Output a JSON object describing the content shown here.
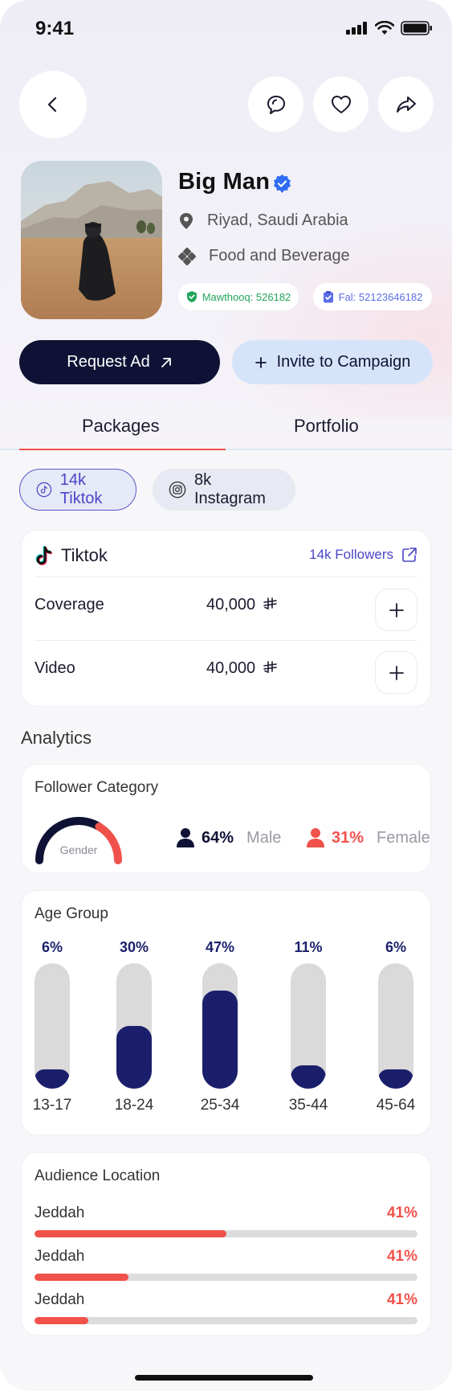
{
  "status_bar": {
    "time": "9:41"
  },
  "profile": {
    "name": "Big Man",
    "location": "Riyad, Saudi Arabia",
    "category": "Food and Beverage",
    "badges": [
      {
        "label": "Mawthooq: 526182",
        "color": "#22a55b"
      },
      {
        "label": "Fal: 52123646182",
        "color": "#5b6ee8"
      }
    ]
  },
  "actions": {
    "request_ad": "Request Ad",
    "invite": "Invite to Campaign"
  },
  "tabs": [
    {
      "label": "Packages",
      "active": true
    },
    {
      "label": "Portfolio",
      "active": false
    }
  ],
  "platform_chips": [
    {
      "label": "14k Tiktok",
      "icon": "tiktok-icon",
      "selected": true
    },
    {
      "label": "8k Instagram",
      "icon": "instagram-icon",
      "selected": false
    }
  ],
  "package_card": {
    "platform": "Tiktok",
    "followers_link": "14k Followers",
    "items": [
      {
        "label": "Coverage",
        "price": "40,000"
      },
      {
        "label": "Video",
        "price": "40,000"
      }
    ],
    "currency_icon": "saudi-riyal-icon"
  },
  "analytics": {
    "title": "Analytics",
    "follower_category": {
      "title": "Follower Category",
      "gauge_label": "Gender",
      "male": {
        "pct": "64%",
        "label": "Male",
        "value": 64
      },
      "female": {
        "pct": "31%",
        "label": "Female",
        "value": 31
      }
    },
    "age_group": {
      "title": "Age Group",
      "bars": [
        {
          "range": "13-17",
          "pct": "6%",
          "value": 6
        },
        {
          "range": "18-24",
          "pct": "30%",
          "value": 30
        },
        {
          "range": "25-34",
          "pct": "47%",
          "value": 47
        },
        {
          "range": "35-44",
          "pct": "11%",
          "value": 11
        },
        {
          "range": "45-64",
          "pct": "6%",
          "value": 6
        }
      ]
    },
    "audience_location": {
      "title": "Audience Location",
      "items": [
        {
          "city": "Jeddah",
          "pct": "41%",
          "fill": 0.5
        },
        {
          "city": "Jeddah",
          "pct": "41%",
          "fill": 0.245
        },
        {
          "city": "Jeddah",
          "pct": "41%",
          "fill": 0.14
        }
      ]
    }
  },
  "colors": {
    "navy": "#0f1235",
    "accent_red": "#f0524b",
    "bar_navy": "#1b1f6b",
    "invite_bg": "#d6e4fa",
    "tiktok_link": "#4b46c7"
  }
}
